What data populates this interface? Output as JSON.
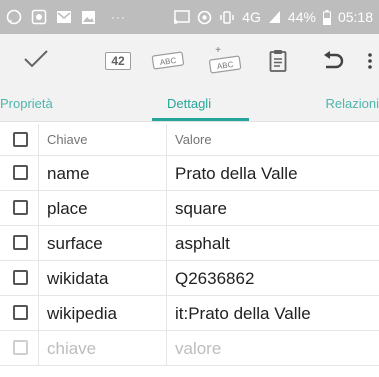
{
  "status_bar": {
    "battery": "44%",
    "time": "05:18",
    "network": "4G",
    "more": "···"
  },
  "toolbar": {
    "num_label": "42",
    "abc_label": "ABC",
    "abc_add_label": "ABC",
    "abc_add_plus": "+",
    "more_label": "⋮"
  },
  "tabs": [
    {
      "label": "Proprietà"
    },
    {
      "label": "Dettagli"
    },
    {
      "label": "Relazioni"
    }
  ],
  "table": {
    "header": {
      "key": "Chiave",
      "value": "Valore"
    },
    "rows": [
      {
        "key": "name",
        "value": "Prato della Valle"
      },
      {
        "key": "place",
        "value": "square"
      },
      {
        "key": "surface",
        "value": "asphalt"
      },
      {
        "key": "wikidata",
        "value": "Q2636862"
      },
      {
        "key": "wikipedia",
        "value": "it:Prato della Valle"
      }
    ],
    "new_row": {
      "key": "chiave",
      "value": "valore"
    }
  }
}
